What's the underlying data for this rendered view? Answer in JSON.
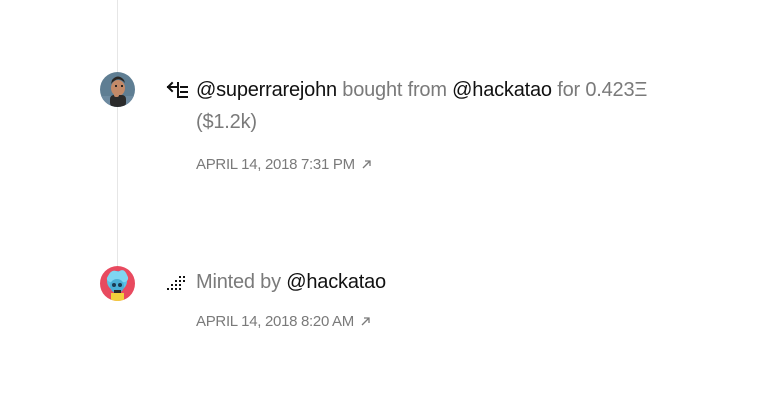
{
  "events": [
    {
      "type": "sale",
      "action_icon": "transfer-arrow-icon",
      "buyer": "@superrarejohn",
      "text_bought_from": "bought from",
      "seller": "@hackatao",
      "text_for": "for 0.423Ξ",
      "usd": "($1.2k)",
      "timestamp": "APRIL 14, 2018 7:31 PM",
      "link_icon": "external-link-arrow-icon"
    },
    {
      "type": "mint",
      "action_icon": "mint-sparkle-icon",
      "text_minted_by": "Minted by",
      "minter": "@hackatao",
      "timestamp": "APRIL 14, 2018 8:20 AM",
      "link_icon": "external-link-arrow-icon"
    }
  ],
  "colors": {
    "primary_text": "#111111",
    "secondary_text": "#7a7a7a",
    "timeline_line": "#e6e6e6"
  }
}
